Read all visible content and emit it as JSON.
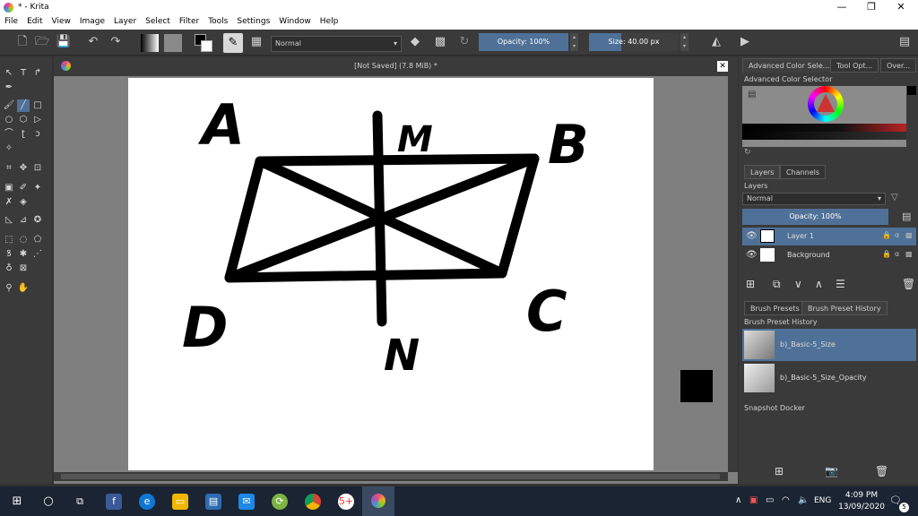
{
  "window": {
    "title": "* - Krita",
    "minimize": "—",
    "maximize": "❐",
    "close": "✕"
  },
  "menu": [
    "File",
    "Edit",
    "View",
    "Image",
    "Layer",
    "Select",
    "Filter",
    "Tools",
    "Settings",
    "Window",
    "Help"
  ],
  "toolbar": {
    "blend_mode": "Normal",
    "opacity": "Opacity: 100%",
    "size": "Size: 40.00 px"
  },
  "document": {
    "title": "[Not Saved]  (7.8 MiB) *"
  },
  "drawing": {
    "labels": {
      "a": "A",
      "b": "B",
      "c": "C",
      "d": "D",
      "m": "M",
      "n": "N"
    },
    "stroke_color": "#000000"
  },
  "docker": {
    "top_tabs": [
      "Advanced Color Sele...",
      "Tool Opt...",
      "Over..."
    ],
    "color_selector_title": "Advanced Color Selector",
    "layer_tabs": [
      "Layers",
      "Channels"
    ],
    "layers_title": "Layers",
    "layers_blend": "Normal",
    "layers_opacity": "Opacity:  100%",
    "layers": [
      {
        "name": "Layer 1",
        "selected": true
      },
      {
        "name": "Background",
        "selected": false
      }
    ],
    "brush_tabs": [
      "Brush Presets",
      "Brush Preset History"
    ],
    "brush_history_title": "Brush Preset History",
    "brush_history": [
      {
        "name": "b)_Basic-5_Size",
        "selected": true
      },
      {
        "name": "b)_Basic-5_Size_Opacity",
        "selected": false
      }
    ],
    "snapshot_title": "Snapshot Docker"
  },
  "taskbar": {
    "language": "ENG",
    "time": "4:09 PM",
    "date": "13/09/2020",
    "notification_count": "5"
  },
  "colors": {
    "accent": "#4f7197",
    "background": "#3a3a3a",
    "canvas_bg": "#7f7f7f",
    "taskbar": "#1a2433"
  }
}
